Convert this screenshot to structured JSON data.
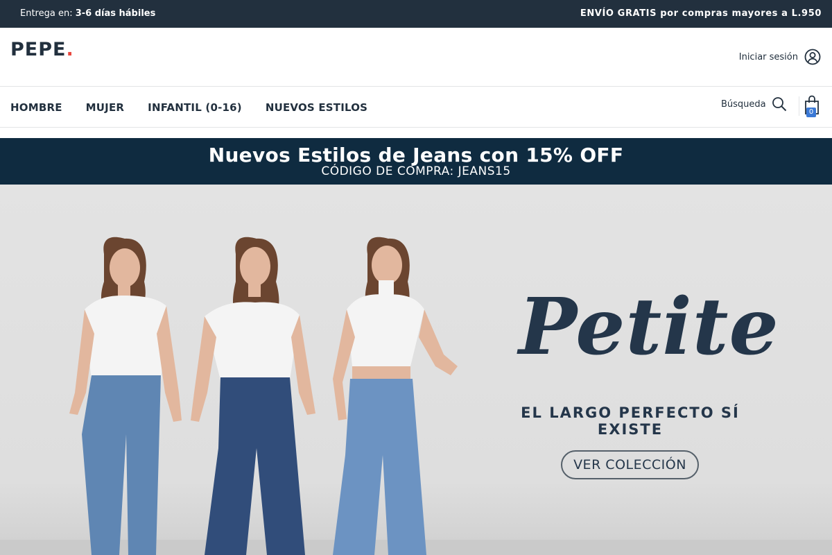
{
  "topbar": {
    "delivery_label": "Entrega en: ",
    "delivery_value": "3-6 días hábiles",
    "shipping": "ENVÍO GRATIS por compras mayores a L.950"
  },
  "header": {
    "logo": "PEPE",
    "logo_dot": ".",
    "login_label": "Iniciar sesión"
  },
  "nav": {
    "items": [
      "HOMBRE",
      "MUJER",
      "INFANTIL (0-16)",
      "NUEVOS ESTILOS"
    ],
    "search_label": "Búsqueda",
    "cart_count": "0"
  },
  "promo": {
    "line1": "Nuevos Estilos de Jeans con  15% OFF",
    "line2": "CÓDIGO DE COMPRA: JEANS15"
  },
  "hero": {
    "title": "Petite",
    "tagline": "EL LARGO PERFECTO SÍ EXISTE",
    "cta": "VER COLECCIÓN"
  },
  "colors": {
    "topbar_bg": "#22303e",
    "promo_bg": "#0f2b40",
    "logo_dot": "#e8483f",
    "cart_badge": "#3b79d6",
    "hero_text": "#24364a"
  },
  "icons": [
    "user-circle-icon",
    "search-icon",
    "shopping-bag-icon"
  ]
}
